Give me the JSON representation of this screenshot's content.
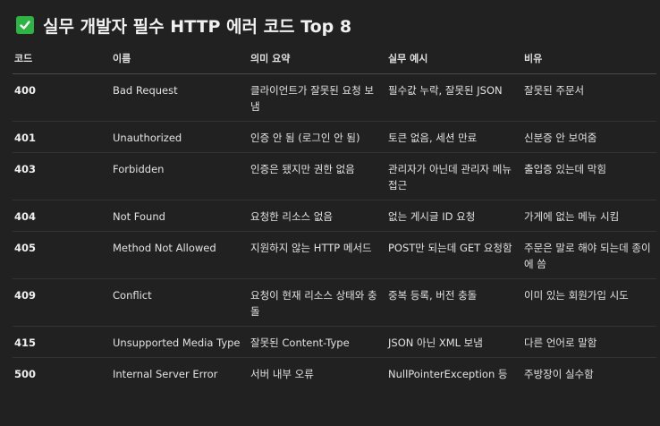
{
  "title": {
    "icon": "check-mark-button-icon",
    "text": "실무 개발자 필수 HTTP 에러 코드 Top 8"
  },
  "table": {
    "headers": [
      "코드",
      "이름",
      "의미 요약",
      "실무 예시",
      "비유"
    ],
    "rows": [
      [
        "400",
        "Bad Request",
        "클라이언트가 잘못된 요청 보냄",
        "필수값 누락, 잘못된 JSON",
        "잘못된 주문서"
      ],
      [
        "401",
        "Unauthorized",
        "인증 안 됨 (로그인 안 됨)",
        "토큰 없음, 세션 만료",
        "신분증 안 보여줌"
      ],
      [
        "403",
        "Forbidden",
        "인증은 됐지만 권한 없음",
        "관리자가 아닌데 관리자 메뉴 접근",
        "출입증 있는데 막힘"
      ],
      [
        "404",
        "Not Found",
        "요청한 리소스 없음",
        "없는 게시글 ID 요청",
        "가게에 없는 메뉴 시킴"
      ],
      [
        "405",
        "Method Not Allowed",
        "지원하지 않는 HTTP 메서드",
        "POST만 되는데 GET 요청함",
        "주문은 말로 해야 되는데 종이에 씀"
      ],
      [
        "409",
        "Conflict",
        "요청이 현재 리소스 상태와 충돌",
        "중복 등록, 버전 충돌",
        "이미 있는 회원가입 시도"
      ],
      [
        "415",
        "Unsupported Media Type",
        "잘못된 Content-Type",
        "JSON 아닌 XML 보냄",
        "다른 언어로 말함"
      ],
      [
        "500",
        "Internal Server Error",
        "서버 내부 오류",
        "NullPointerException 등",
        "주방장이 실수함"
      ]
    ]
  },
  "colors": {
    "background": "#212121",
    "check_icon": "#2fb344"
  }
}
